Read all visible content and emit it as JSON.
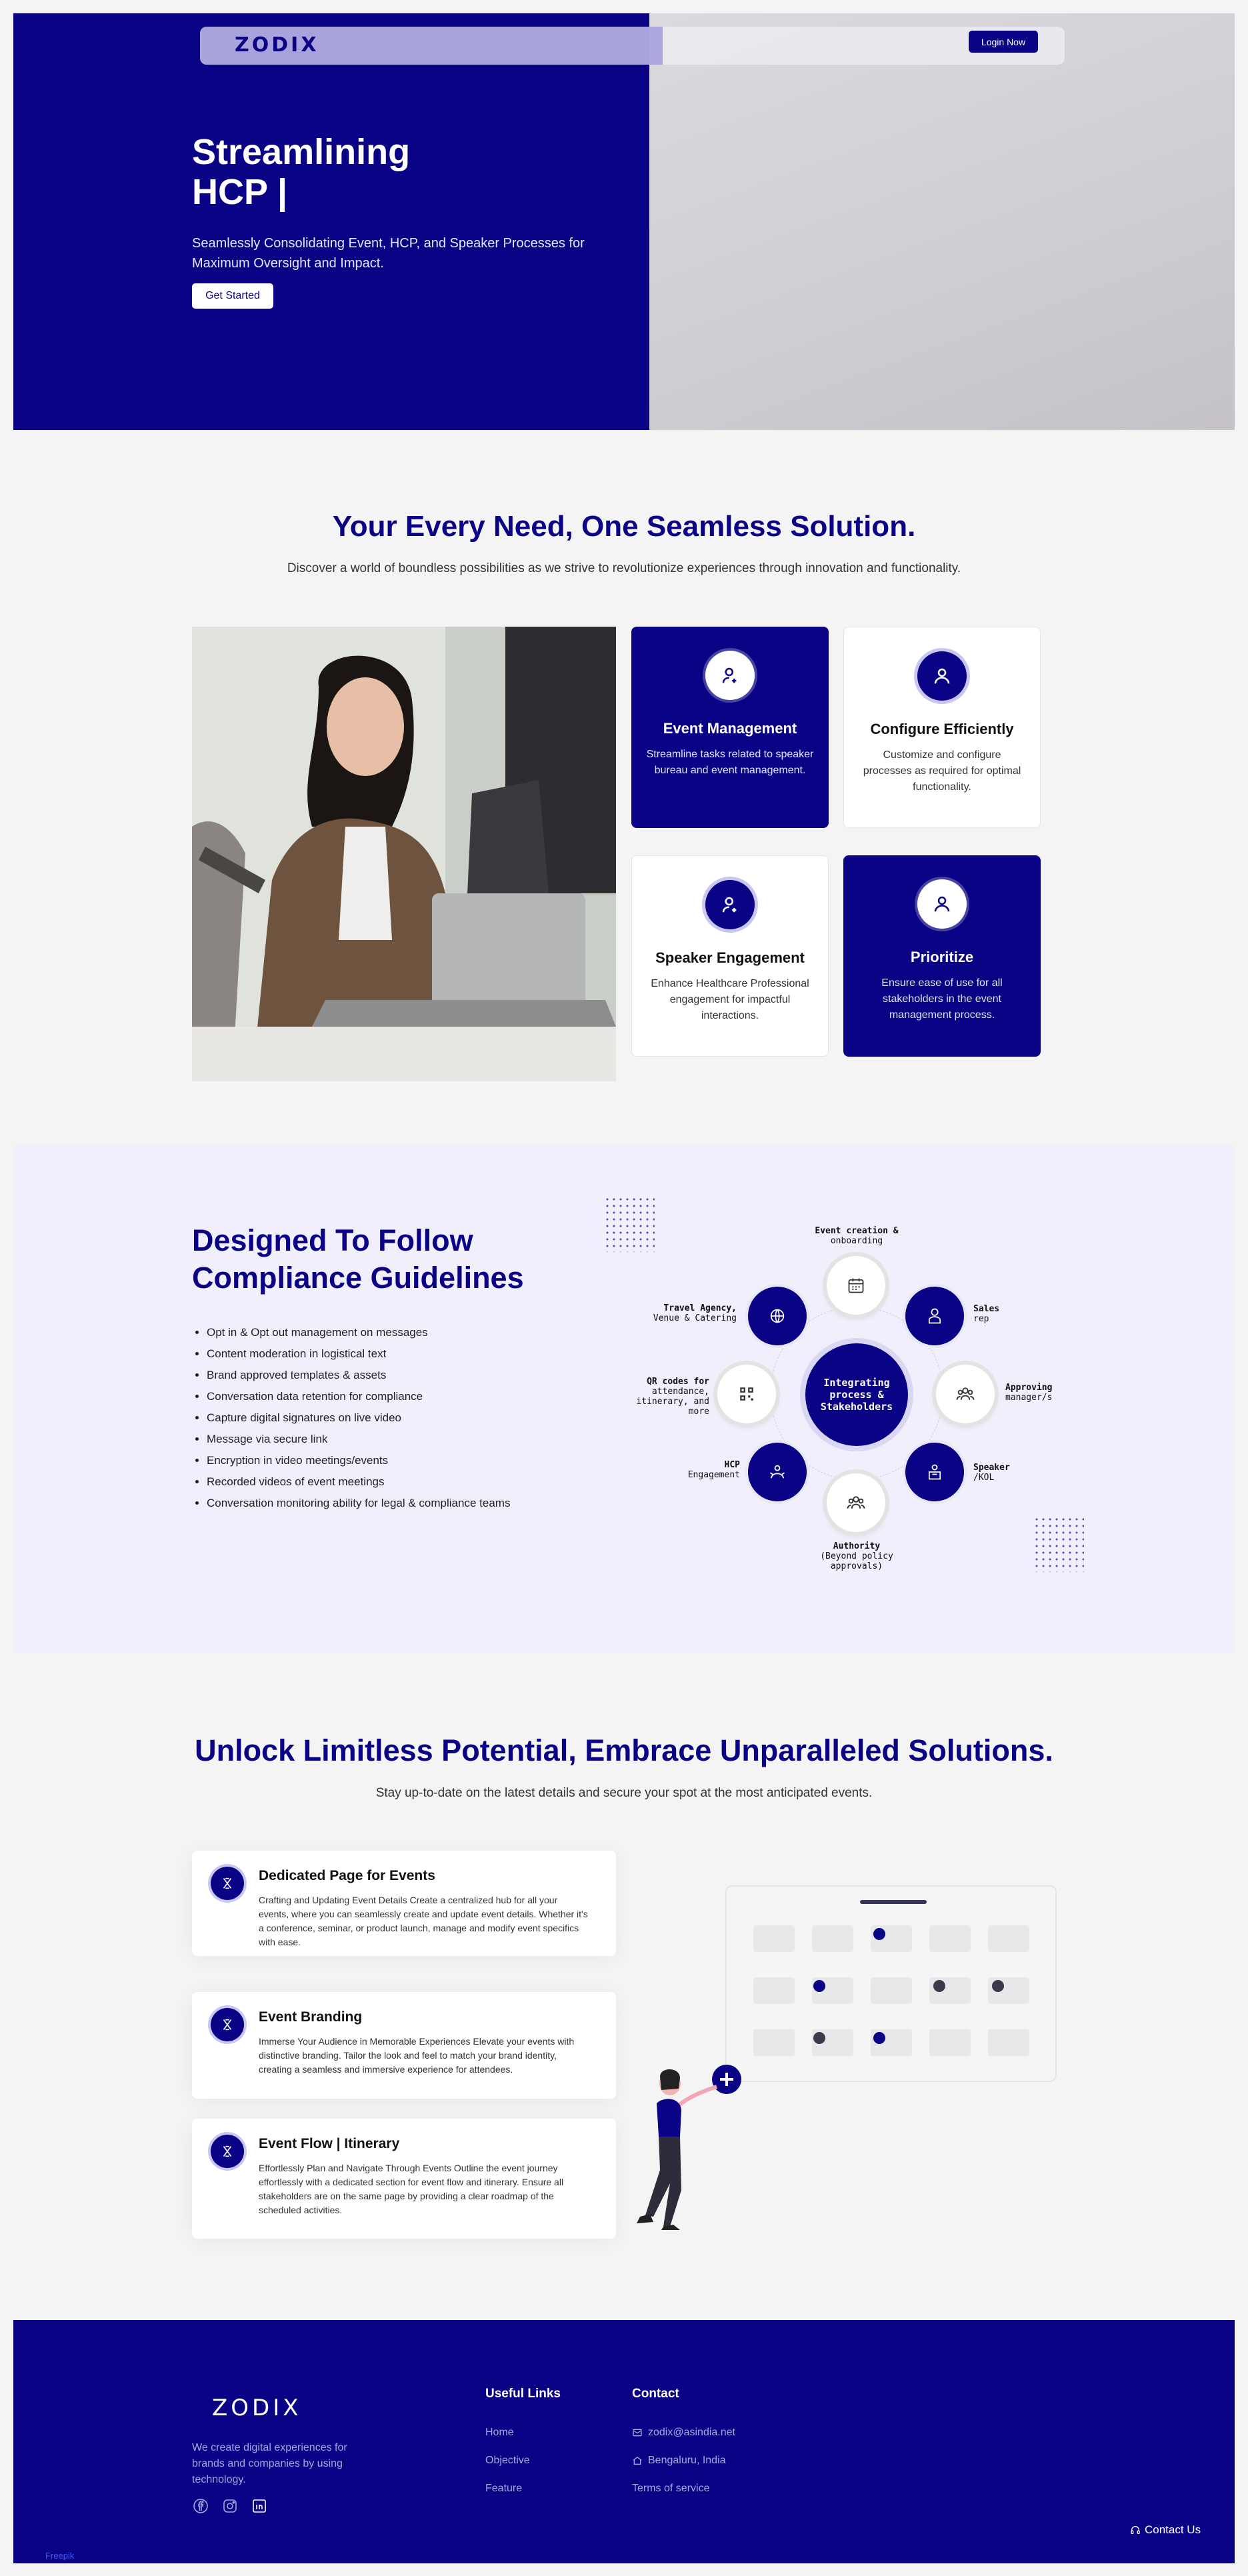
{
  "nav": {
    "logo": "ZODIX",
    "login_label": "Login Now"
  },
  "hero": {
    "title_line1": "Streamlining",
    "title_line2": "HCP |",
    "subtitle": "Seamlessly Consolidating Event, HCP, and Speaker Processes for Maximum Oversight and Impact.",
    "cta_label": "Get Started"
  },
  "solutions": {
    "title": "Your Every Need, One Seamless Solution.",
    "subtitle": "Discover a world of boundless possibilities as we strive to revolutionize experiences through innovation and functionality.",
    "cards": [
      {
        "title": "Event Management",
        "text": "Streamline tasks related to speaker bureau and event management."
      },
      {
        "title": "Configure Efficiently",
        "text": "Customize and configure processes as required for optimal functionality."
      },
      {
        "title": "Speaker Engagement",
        "text": "Enhance Healthcare Professional engagement for impactful interactions."
      },
      {
        "title": "Prioritize",
        "text": "Ensure ease of use for all stakeholders in the event management process."
      }
    ]
  },
  "compliance": {
    "title": "Designed To Follow Compliance Guidelines",
    "items": [
      "Opt in & Opt out management on messages",
      "Content moderation in logistical text",
      "Brand approved templates & assets",
      "Conversation data retention for compliance",
      "Capture digital signatures on live video",
      "Message via secure link",
      "Encryption in video meetings/events",
      "Recorded videos of event meetings",
      "Conversation monitoring ability for legal & compliance teams"
    ],
    "hub_label": "Integrating process & Stakeholders",
    "nodes": {
      "event_creation": {
        "title": "Event creation &",
        "sub": "onboarding"
      },
      "sales": {
        "title": "Sales",
        "sub": "rep"
      },
      "approving": {
        "title": "Approving",
        "sub": "manager/s"
      },
      "speaker": {
        "title": "Speaker",
        "sub": "/KOL"
      },
      "authority": {
        "title": "Authority",
        "sub": "(Beyond policy approvals)"
      },
      "hcp": {
        "title": "HCP",
        "sub": "Engagement"
      },
      "qr": {
        "title": "QR codes for",
        "sub": "attendance, itinerary, and more"
      },
      "travel": {
        "title": "Travel Agency,",
        "sub": "Venue & Catering"
      }
    }
  },
  "potential": {
    "title": "Unlock Limitless Potential, Embrace Unparalleled Solutions.",
    "subtitle": "Stay up-to-date on the latest details and secure your spot at the most anticipated events.",
    "features": [
      {
        "title": "Dedicated Page for Events",
        "text": "Crafting and Updating Event Details Create a centralized hub for all your events, where you can seamlessly create and update event details. Whether it's a conference, seminar, or product launch, manage and modify event specifics with ease."
      },
      {
        "title": "Event Branding",
        "text": "Immerse Your Audience in Memorable Experiences Elevate your events with distinctive branding. Tailor the look and feel to match your brand identity, creating a seamless and immersive experience for attendees."
      },
      {
        "title": "Event Flow | Itinerary",
        "text": "Effortlessly Plan and Navigate Through Events Outline the event journey effortlessly with a dedicated section for event flow and itinerary. Ensure all stakeholders are on the same page by providing a clear roadmap of the scheduled activities."
      }
    ]
  },
  "footer": {
    "logo": "ZODIX",
    "description": "We create digital experiences for brands and companies by using technology.",
    "useful_links_title": "Useful Links",
    "links": [
      "Home",
      "Objective",
      "Feature"
    ],
    "contact_title": "Contact",
    "email": "zodix@asindia.net",
    "location": "Bengaluru, India",
    "terms": "Terms of service",
    "contact_us": "Contact Us",
    "credit": "Freepik"
  },
  "colors": {
    "brand": "#0b0385",
    "background": "#f4f4f4",
    "tint": "#f0effb"
  }
}
